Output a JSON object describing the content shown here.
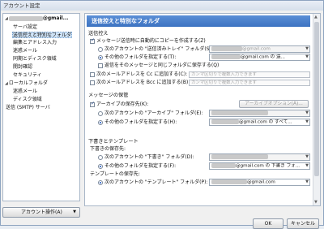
{
  "window": {
    "title": "アカウント設定"
  },
  "tree": {
    "account_suffix": "@gmail...",
    "items": [
      "サーバ設定",
      "送信控えと特別なフォルダ",
      "編集とアドレス入力",
      "迷惑メール",
      "同期とディスク領域",
      "開封確認",
      "セキュリティ"
    ],
    "local_folders": "ローカルフォルダ",
    "local_items": [
      "迷惑メール",
      "ディスク領域"
    ],
    "smtp": "送信 (SMTP) サーバ",
    "account_actions": "アカウント操作(A)"
  },
  "pane": {
    "title": "送信控えと特別なフォルダ",
    "sent": {
      "header": "送信控え",
      "copy_check": "メッセージ送信時に自動的にコピーを作成する(Z)",
      "radio_sent_folder": "次のアカウントの \"送信済みトレイ\" フォルダ(S):",
      "sent_folder_value": "@gmail.com",
      "radio_other": "その他のフォルダを指定する(T):",
      "other_value": "@gmail.com の 送...",
      "reply_check": "返信をそのメッセージと同じフォルダに保存する(Q)",
      "cc_check": "次のメールアドレスを Cc に追加する(C):",
      "bcc_check": "次のメールアドレスを Bcc に追加する(B):",
      "addr_placeholder": "カンマ区切りで複数入力できます"
    },
    "archive": {
      "header": "メッセージの保管",
      "keep_check": "アーカイブの保存先(K):",
      "archive_options": "アーカイブオプション(A)...",
      "radio_archive_folder": "次のアカウントの \"アーカイブ\" フォルダ(E):",
      "archive_folder_value": "",
      "radio_other": "その他のフォルダを指定する(H):",
      "other_value": "@gmail.com の すべて..."
    },
    "drafts": {
      "header": "下書きとテンプレート",
      "drafts_label": "下書きの保存先:",
      "radio_drafts_folder": "次のアカウントの \"下書き\" フォルダ(D):",
      "drafts_folder_value": "",
      "radio_other": "その他のフォルダを指定する(F):",
      "other_value": "@gmail.com の 下書き フォ...",
      "templates_label": "テンプレートの保存先:",
      "radio_templates_folder": "次のアカウントの \"テンプレート\" フォルダ(P):",
      "templates_folder_value": "@gmail.com"
    }
  },
  "footer": {
    "ok": "OK",
    "cancel": "キャンセル"
  }
}
